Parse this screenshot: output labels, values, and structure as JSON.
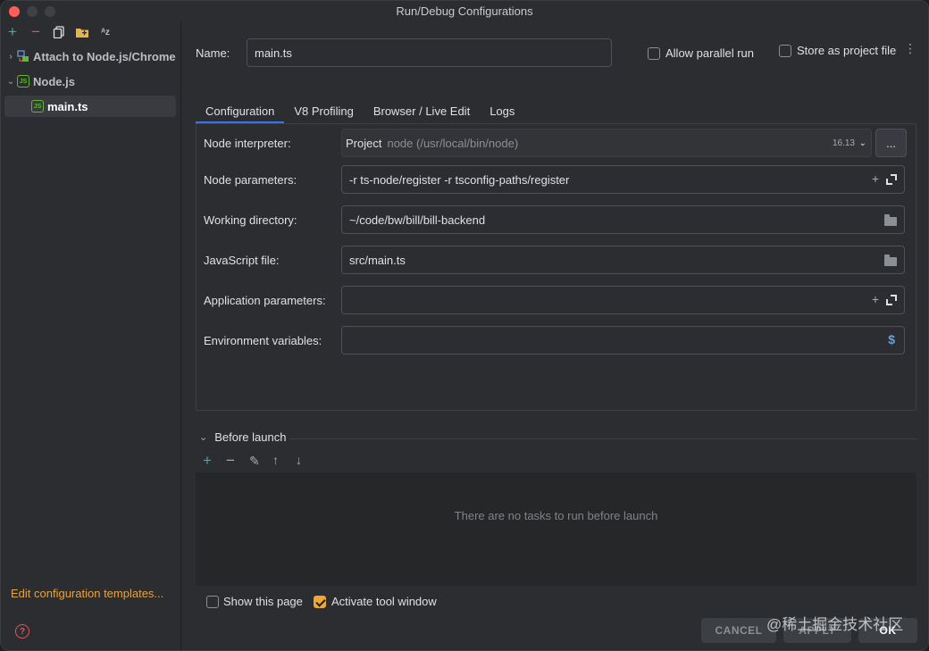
{
  "window": {
    "title": "Run/Debug Configurations"
  },
  "sidebar": {
    "toolbar": [
      "add-icon",
      "remove-icon",
      "copy-icon",
      "folder-icon",
      "sort-az-icon"
    ],
    "items": [
      {
        "label": "Attach to Node.js/Chrome",
        "expanded": false
      },
      {
        "label": "Node.js",
        "expanded": true
      },
      {
        "label": "main.ts",
        "selected": true
      }
    ],
    "edit_templates": "Edit configuration templates..."
  },
  "name_row": {
    "label": "Name:",
    "value": "main.ts",
    "allow_parallel": {
      "label": "Allow parallel run",
      "checked": false
    },
    "store_as_project": {
      "label": "Store as project file",
      "checked": false
    }
  },
  "tabs": [
    {
      "label": "Configuration",
      "active": true
    },
    {
      "label": "V8 Profiling",
      "active": false
    },
    {
      "label": "Browser / Live Edit",
      "active": false
    },
    {
      "label": "Logs",
      "active": false
    }
  ],
  "config": {
    "node_interpreter": {
      "label": "Node interpreter:",
      "project": "Project",
      "path": "node (/usr/local/bin/node)",
      "version": "16.13",
      "more": "..."
    },
    "node_parameters": {
      "label": "Node parameters:",
      "value": "-r ts-node/register -r tsconfig-paths/register"
    },
    "working_directory": {
      "label": "Working directory:",
      "value": "~/code/bw/bill/bill-backend"
    },
    "javascript_file": {
      "label": "JavaScript file:",
      "value": "src/main.ts"
    },
    "application_parameters": {
      "label": "Application parameters:",
      "value": ""
    },
    "environment_variables": {
      "label": "Environment variables:",
      "value": "",
      "icon": "$"
    }
  },
  "before_launch": {
    "title": "Before launch",
    "empty_text": "There are no tasks to run before launch"
  },
  "footer": {
    "show_this_page": {
      "label": "Show this page",
      "checked": false
    },
    "activate_tool_window": {
      "label": "Activate tool window",
      "checked": true
    },
    "cancel": "CANCEL",
    "apply": "APPLY",
    "ok": "OK",
    "watermark": "@稀土掘金技术社区"
  },
  "colors": {
    "accent": "#3574f0",
    "checkbox_checked": "#f0a732",
    "link": "#e8a33d",
    "add": "#3ab0a8"
  }
}
